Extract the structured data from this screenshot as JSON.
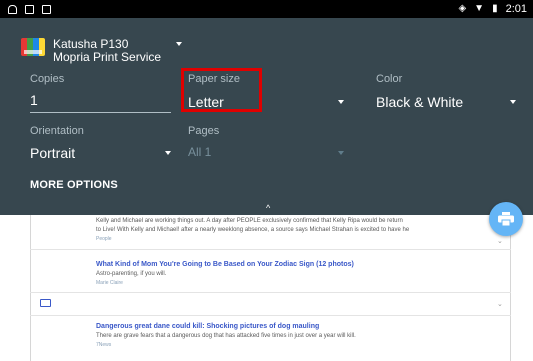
{
  "status_bar": {
    "time": "2:01",
    "icons": [
      "notification-icon",
      "image-icon",
      "sd-card-icon",
      "vibrate-icon",
      "wifi-icon",
      "battery-icon"
    ]
  },
  "print_panel": {
    "printer_name": "Katusha P130",
    "printer_service": "Mopria Print Service",
    "copies_label": "Copies",
    "copies_value": "1",
    "paper_size_label": "Paper size",
    "paper_size_value": "Letter",
    "color_label": "Color",
    "color_value": "Black & White",
    "orientation_label": "Orientation",
    "orientation_value": "Portrait",
    "pages_label": "Pages",
    "pages_value": "All 1",
    "more_options": "MORE OPTIONS"
  },
  "feed": {
    "item1_snippet_line1": "Kelly and Michael are working things out. A day after PEOPLE exclusively confirmed that Kelly Ripa would be return",
    "item1_snippet_line2": "to Live! With Kelly and Michael! after a nearly weeklong absence, a source says Michael Strahan is excited to have he",
    "item1_source": "People",
    "item2_title": "What Kind of Mom You're Going to Be Based on Your Zodiac Sign",
    "item2_count": "(12 photos)",
    "item2_snippet": "Astro-parenting, if you will.",
    "item2_source": "Marie Claire",
    "item3_title": "Dangerous great dane could kill: Shocking pictures of dog mauling",
    "item3_snippet": "There are grave fears that a dangerous dog that has attacked five times in just over a year will kill.",
    "item3_source": "7News"
  },
  "colors": {
    "panel_bg": "#37474f",
    "accent_fab": "#64b5f6",
    "highlight_box": "#e00000",
    "link_blue": "#3a58c8"
  }
}
